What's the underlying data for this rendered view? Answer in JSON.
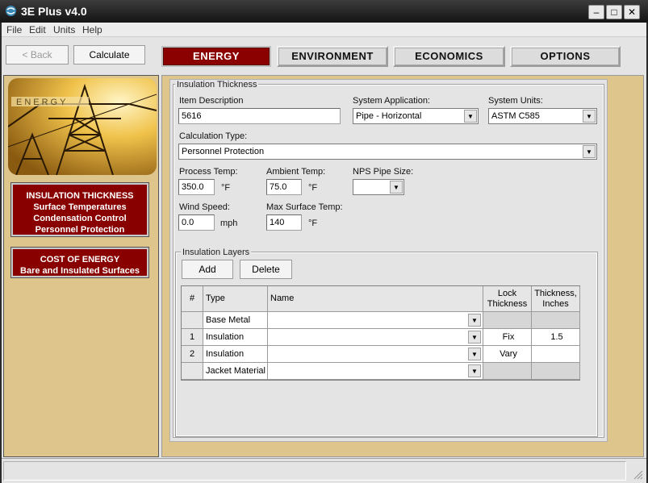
{
  "window": {
    "title": "3E Plus v4.0"
  },
  "menu": [
    "File",
    "Edit",
    "Units",
    "Help"
  ],
  "toolbar": {
    "back_label": "< Back",
    "calculate_label": "Calculate"
  },
  "tabs": [
    "ENERGY",
    "ENVIRONMENT",
    "ECONOMICS",
    "OPTIONS"
  ],
  "active_tab": "ENERGY",
  "sidebar": {
    "image_text": "ENERGY",
    "box1": [
      "INSULATION THICKNESS",
      "Surface Temperatures",
      "Condensation Control",
      "Personnel Protection"
    ],
    "box2": [
      "COST OF ENERGY",
      "Bare and Insulated Surfaces"
    ]
  },
  "form": {
    "group_title": "Insulation Thickness",
    "item_description_label": "Item Description",
    "item_description_value": "5616",
    "system_application_label": "System Application:",
    "system_application_value": "Pipe - Horizontal",
    "system_units_label": "System Units:",
    "system_units_value": "ASTM C585",
    "calculation_type_label": "Calculation Type:",
    "calculation_type_value": "Personnel Protection",
    "process_temp_label": "Process Temp:",
    "process_temp_value": "350.0",
    "process_temp_unit": "°F",
    "ambient_temp_label": "Ambient Temp:",
    "ambient_temp_value": "75.0",
    "ambient_temp_unit": "°F",
    "nps_pipe_size_label": "NPS Pipe Size:",
    "nps_pipe_size_value": "",
    "wind_speed_label": "Wind Speed:",
    "wind_speed_value": "0.0",
    "wind_speed_unit": "mph",
    "max_surface_temp_label": "Max Surface Temp:",
    "max_surface_temp_value": "140",
    "max_surface_temp_unit": "°F"
  },
  "layers": {
    "group_title": "Insulation Layers",
    "add_label": "Add",
    "delete_label": "Delete",
    "headers": {
      "num": "#",
      "type": "Type",
      "name": "Name",
      "lock": [
        "Lock",
        "Thickness"
      ],
      "thickness": [
        "Thickness,",
        "Inches"
      ]
    },
    "rows": [
      {
        "num": "",
        "type": "Base Metal",
        "name": "",
        "lock": "",
        "thickness": ""
      },
      {
        "num": "1",
        "type": "Insulation",
        "name": "",
        "lock": "Fix",
        "thickness": "1.5"
      },
      {
        "num": "2",
        "type": "Insulation",
        "name": "",
        "lock": "Vary",
        "thickness": ""
      },
      {
        "num": "",
        "type": "Jacket Material",
        "name": "",
        "lock": "",
        "thickness": ""
      }
    ]
  },
  "colors": {
    "accent_red": "#880000",
    "panel_tan": "#ddc58c"
  }
}
